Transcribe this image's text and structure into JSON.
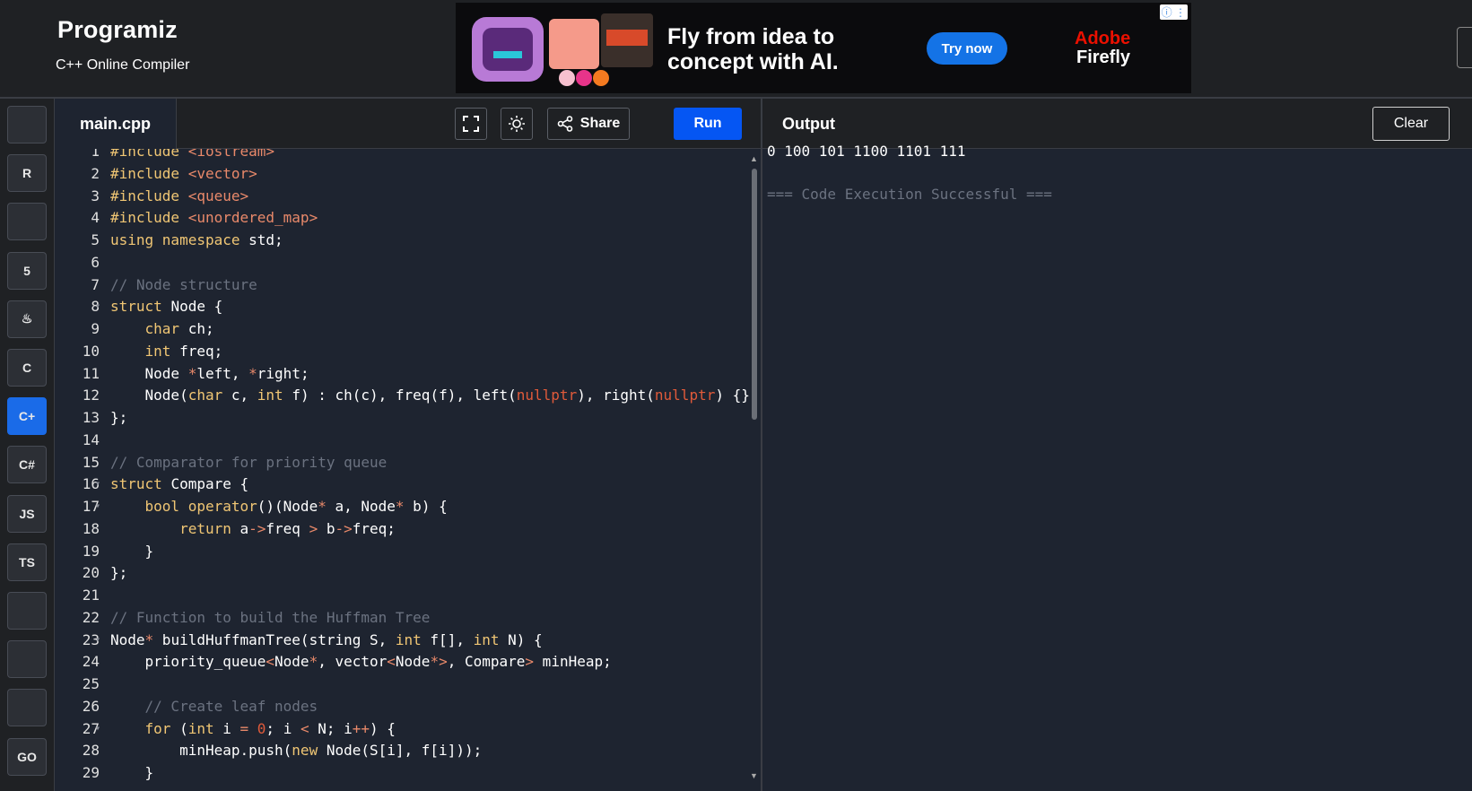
{
  "header": {
    "logo": "Programiz",
    "subtitle": "C++ Online Compiler"
  },
  "ad": {
    "headline": "Fly from idea to concept with AI.",
    "button": "Try now",
    "brand_line1": "Adobe",
    "brand_line2": "Firefly",
    "info": "ⓘ ⋮"
  },
  "sidebar": {
    "items": [
      {
        "name": "python",
        "label": ""
      },
      {
        "name": "r",
        "label": "R"
      },
      {
        "name": "sql",
        "label": ""
      },
      {
        "name": "html",
        "label": "5"
      },
      {
        "name": "java",
        "label": "♨"
      },
      {
        "name": "c",
        "label": "C"
      },
      {
        "name": "cpp",
        "label": "C+"
      },
      {
        "name": "csharp",
        "label": "C#"
      },
      {
        "name": "js",
        "label": "JS"
      },
      {
        "name": "ts",
        "label": "TS"
      },
      {
        "name": "scala",
        "label": ""
      },
      {
        "name": "swift",
        "label": ""
      },
      {
        "name": "rust",
        "label": ""
      },
      {
        "name": "go",
        "label": "GO"
      }
    ],
    "active": "cpp"
  },
  "editor": {
    "file_name": "main.cpp",
    "share_label": "Share",
    "run_label": "Run",
    "lines": [
      [
        [
          "#include ",
          "kw"
        ],
        [
          "<iostream>",
          "inc"
        ]
      ],
      [
        [
          "#include ",
          "kw"
        ],
        [
          "<vector>",
          "inc"
        ]
      ],
      [
        [
          "#include ",
          "kw"
        ],
        [
          "<queue>",
          "inc"
        ]
      ],
      [
        [
          "#include ",
          "kw"
        ],
        [
          "<unordered_map>",
          "inc"
        ]
      ],
      [
        [
          "using namespace ",
          "kw"
        ],
        [
          "std;",
          "p"
        ]
      ],
      [],
      [
        [
          "// Node structure",
          "cm"
        ]
      ],
      [
        [
          "struct ",
          "kw"
        ],
        [
          "Node {",
          "p"
        ]
      ],
      [
        [
          "    ",
          "p"
        ],
        [
          "char ",
          "kw"
        ],
        [
          "ch;",
          "p"
        ]
      ],
      [
        [
          "    ",
          "p"
        ],
        [
          "int ",
          "kw"
        ],
        [
          "freq;",
          "p"
        ]
      ],
      [
        [
          "    Node ",
          "p"
        ],
        [
          "*",
          "op"
        ],
        [
          "left, ",
          "p"
        ],
        [
          "*",
          "op"
        ],
        [
          "right;",
          "p"
        ]
      ],
      [
        [
          "    Node(",
          "p"
        ],
        [
          "char ",
          "kw"
        ],
        [
          "c, ",
          "p"
        ],
        [
          "int ",
          "kw"
        ],
        [
          "f) : ch(c), freq(f), left(",
          "p"
        ],
        [
          "nullptr",
          "num"
        ],
        [
          "), right(",
          "p"
        ],
        [
          "nullptr",
          "num"
        ],
        [
          ") {}",
          "p"
        ]
      ],
      [
        [
          "};",
          "p"
        ]
      ],
      [],
      [
        [
          "// Comparator for priority queue",
          "cm"
        ]
      ],
      [
        [
          "struct ",
          "kw"
        ],
        [
          "Compare {",
          "p"
        ]
      ],
      [
        [
          "    ",
          "p"
        ],
        [
          "bool ",
          "kw"
        ],
        [
          "operator",
          "fn"
        ],
        [
          "()(Node",
          "p"
        ],
        [
          "*",
          "op"
        ],
        [
          " a, Node",
          "p"
        ],
        [
          "*",
          "op"
        ],
        [
          " b) {",
          "p"
        ]
      ],
      [
        [
          "        ",
          "p"
        ],
        [
          "return ",
          "kw"
        ],
        [
          "a",
          "p"
        ],
        [
          "->",
          "op"
        ],
        [
          "freq ",
          "p"
        ],
        [
          ">",
          "op"
        ],
        [
          " b",
          "p"
        ],
        [
          "->",
          "op"
        ],
        [
          "freq;",
          "p"
        ]
      ],
      [
        [
          "    }",
          "p"
        ]
      ],
      [
        [
          "};",
          "p"
        ]
      ],
      [],
      [
        [
          "// Function to build the Huffman Tree",
          "cm"
        ]
      ],
      [
        [
          "Node",
          "p"
        ],
        [
          "*",
          "op"
        ],
        [
          " buildHuffmanTree(string S, ",
          "p"
        ],
        [
          "int ",
          "kw"
        ],
        [
          "f[], ",
          "p"
        ],
        [
          "int ",
          "kw"
        ],
        [
          "N) {",
          "p"
        ]
      ],
      [
        [
          "    priority_queue",
          "p"
        ],
        [
          "<",
          "op"
        ],
        [
          "Node",
          "p"
        ],
        [
          "*",
          "op"
        ],
        [
          ", vector",
          "p"
        ],
        [
          "<",
          "op"
        ],
        [
          "Node",
          "p"
        ],
        [
          "*>",
          "op"
        ],
        [
          ", Compare",
          "p"
        ],
        [
          ">",
          "op"
        ],
        [
          " minHeap;",
          "p"
        ]
      ],
      [],
      [
        [
          "    // Create leaf nodes",
          "cm"
        ]
      ],
      [
        [
          "    ",
          "p"
        ],
        [
          "for ",
          "kw"
        ],
        [
          "(",
          "p"
        ],
        [
          "int ",
          "kw"
        ],
        [
          "i ",
          "p"
        ],
        [
          "=",
          "op"
        ],
        [
          " ",
          "p"
        ],
        [
          "0",
          "num"
        ],
        [
          "; i ",
          "p"
        ],
        [
          "<",
          "op"
        ],
        [
          " N; i",
          "p"
        ],
        [
          "++",
          "op"
        ],
        [
          ") {",
          "p"
        ]
      ],
      [
        [
          "        minHeap.push(",
          "p"
        ],
        [
          "new ",
          "kw"
        ],
        [
          "Node(S[i], f[i]));",
          "p"
        ]
      ],
      [
        [
          "    }",
          "p"
        ]
      ]
    ],
    "fold_lines": [
      8,
      16,
      17,
      23,
      27
    ]
  },
  "output": {
    "title": "Output",
    "clear_label": "Clear",
    "lines": [
      "0 100 101 1100 1101 111",
      "",
      "=== Code Execution Successful ==="
    ]
  },
  "colors": {
    "kw": "#f0c674",
    "inc": "#e9896a",
    "cm": "#6b7280",
    "num": "#e05a3a",
    "op": "#e9896a",
    "fn": "#f0c674",
    "p": "#ffffff",
    "accent": "#0556f3"
  }
}
